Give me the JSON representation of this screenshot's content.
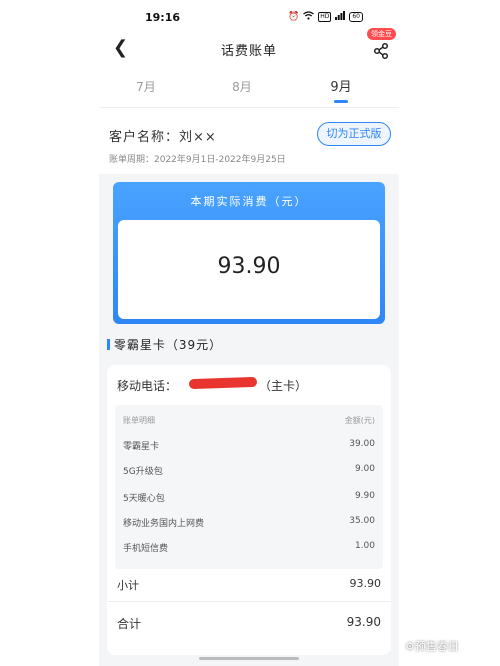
{
  "status_bar": {
    "time": "19:16",
    "icons": [
      "alarm-icon",
      "wifi-icon",
      "hd-icon",
      "signal-icon",
      "battery-icon"
    ],
    "hd_text": "HD",
    "battery_text": "60"
  },
  "header": {
    "title": "话费账单",
    "coin_badge": "领金豆"
  },
  "tabs": [
    {
      "label": "7月",
      "active": false
    },
    {
      "label": "8月",
      "active": false
    },
    {
      "label": "9月",
      "active": true
    }
  ],
  "info": {
    "customer_name": "客户名称：刘××",
    "switch_label": "切为正式版",
    "bill_period": "账单周期：2022年9月1日-2022年9月25日"
  },
  "total": {
    "title": "本期实际消费（元）",
    "amount": "93.90"
  },
  "package": {
    "title": "零霸星卡（39元）"
  },
  "detail": {
    "phone_label": "移动电话：",
    "main_tag": "（主卡）",
    "head_left": "账单明细",
    "head_right": "金额(元)",
    "rows": [
      {
        "name": "零霸星卡",
        "amount": "39.00"
      },
      {
        "name": "5G升级包",
        "amount": "9.00"
      },
      {
        "name": "5天暖心包",
        "amount": "9.90"
      },
      {
        "name": "移动业务国内上网费",
        "amount": "35.00"
      },
      {
        "name": "手机短信费",
        "amount": "1.00"
      }
    ],
    "subtotal_label": "小计",
    "subtotal_amount": "93.90",
    "grand_total_label": "合计",
    "grand_total_amount": "93.90"
  },
  "watermark": "⚙预售春日",
  "colors": {
    "accent": "#2f86f6",
    "redaction": "#e8352f",
    "badge": "#ff4d4f"
  }
}
